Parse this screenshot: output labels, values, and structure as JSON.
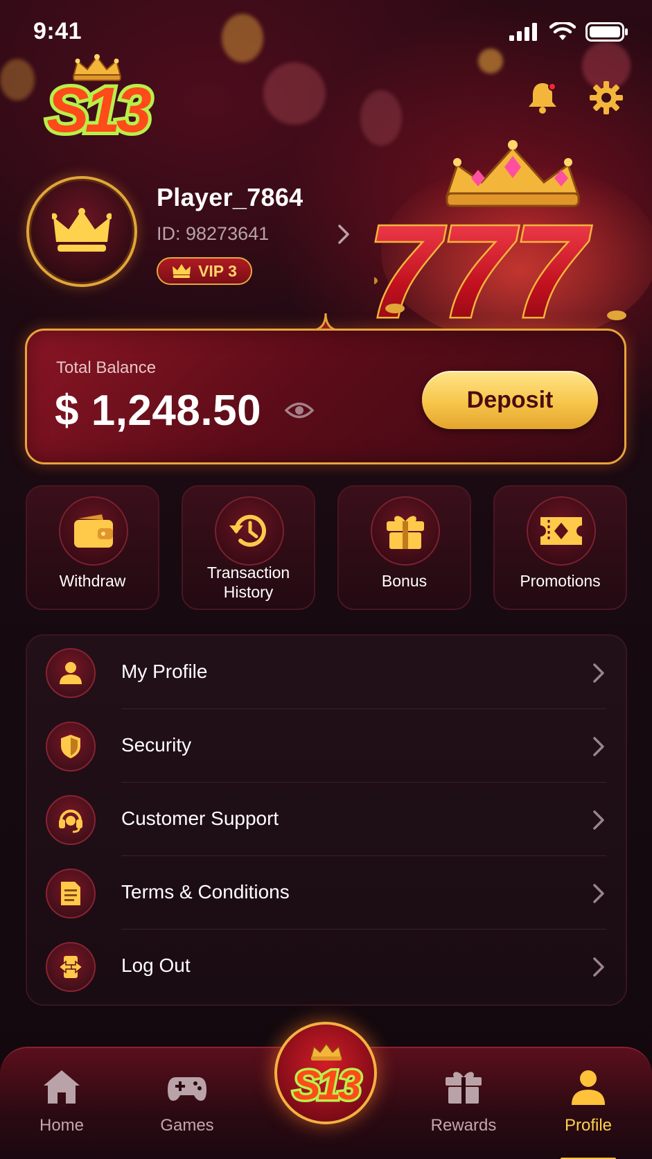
{
  "status_bar": {
    "time": "9:41"
  },
  "brand": {
    "logo_text": "S13",
    "primary_color": "#ffd24d",
    "accent_red": "#b01a22"
  },
  "profile": {
    "name": "Player_7864",
    "id": "ID: 98273641",
    "vip": "VIP 3"
  },
  "balance": {
    "label": "Total Balance",
    "value": "$ 1,248.50",
    "deposit_label": "Deposit"
  },
  "quick_actions": [
    {
      "label": "Withdraw",
      "icon": "wallet-icon"
    },
    {
      "label": "Transaction History",
      "icon": "history-icon"
    },
    {
      "label": "Bonus",
      "icon": "gift-icon"
    },
    {
      "label": "Promotions",
      "icon": "ticket-icon"
    }
  ],
  "menu": [
    {
      "label": "My Profile",
      "icon": "user-icon"
    },
    {
      "label": "Security",
      "icon": "shield-icon"
    },
    {
      "label": "Customer Support",
      "icon": "headset-icon"
    },
    {
      "label": "Terms & Conditions",
      "icon": "document-icon"
    },
    {
      "label": "Log Out",
      "icon": "logout-icon"
    }
  ],
  "bottom_nav": [
    {
      "label": "Home",
      "icon": "home-icon",
      "active": false
    },
    {
      "label": "Games",
      "icon": "gamepad-icon",
      "active": false
    },
    {
      "label": "Rewards",
      "icon": "gift-icon",
      "active": false
    },
    {
      "label": "Profile",
      "icon": "user-icon",
      "active": true
    }
  ]
}
